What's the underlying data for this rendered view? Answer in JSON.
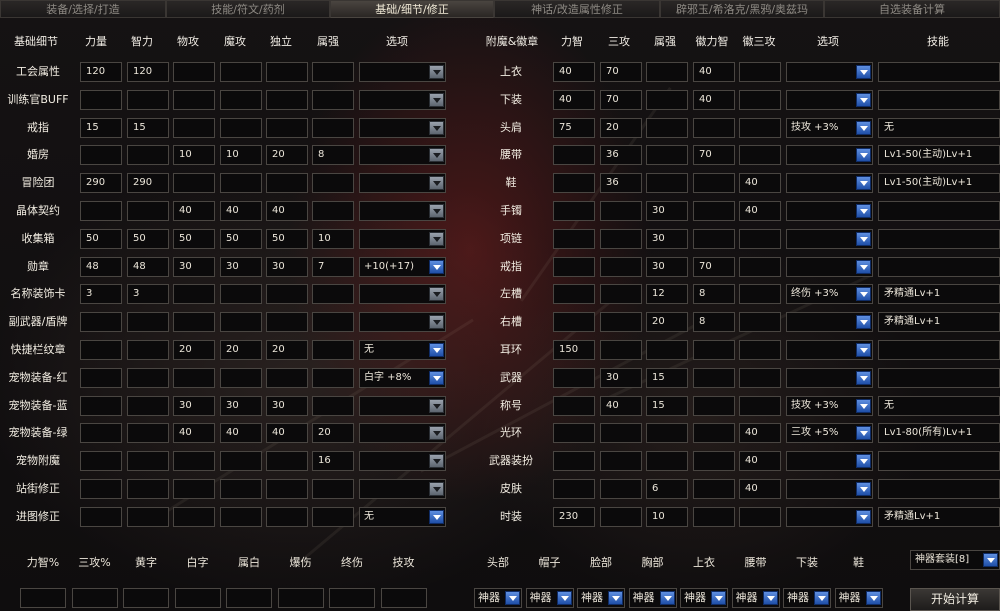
{
  "tabs": [
    "装备/选择/打造",
    "技能/符文/药剂",
    "基础/细节/修正",
    "神话/改造属性修正",
    "辟邪玉/希洛克/黑鸦/奥兹玛",
    "自选装备计算"
  ],
  "active_tab": 2,
  "left": {
    "headers": [
      "基础细节",
      "力量",
      "智力",
      "物攻",
      "魔攻",
      "独立",
      "属强",
      "选项"
    ],
    "rows": [
      {
        "label": "工会属性",
        "values": [
          "120",
          "120",
          "",
          "",
          "",
          ""
        ],
        "option": "",
        "blue": false
      },
      {
        "label": "训练官BUFF",
        "values": [
          "",
          "",
          "",
          "",
          "",
          ""
        ],
        "option": "",
        "blue": false
      },
      {
        "label": "戒指",
        "values": [
          "15",
          "15",
          "",
          "",
          "",
          ""
        ],
        "option": "",
        "blue": false
      },
      {
        "label": "婚房",
        "values": [
          "",
          "",
          "10",
          "10",
          "20",
          "8"
        ],
        "option": "",
        "blue": false
      },
      {
        "label": "冒险团",
        "values": [
          "290",
          "290",
          "",
          "",
          "",
          ""
        ],
        "option": "",
        "blue": false
      },
      {
        "label": "晶体契约",
        "values": [
          "",
          "",
          "40",
          "40",
          "40",
          ""
        ],
        "option": "",
        "blue": false
      },
      {
        "label": "收集箱",
        "values": [
          "50",
          "50",
          "50",
          "50",
          "50",
          "10"
        ],
        "option": "",
        "blue": false
      },
      {
        "label": "勋章",
        "values": [
          "48",
          "48",
          "30",
          "30",
          "30",
          "7"
        ],
        "option": "+10(+17)",
        "blue": true
      },
      {
        "label": "名称装饰卡",
        "values": [
          "3",
          "3",
          "",
          "",
          "",
          ""
        ],
        "option": "",
        "blue": false
      },
      {
        "label": "副武器/盾牌",
        "values": [
          "",
          "",
          "",
          "",
          "",
          ""
        ],
        "option": "",
        "blue": false
      },
      {
        "label": "快捷栏纹章",
        "values": [
          "",
          "",
          "20",
          "20",
          "20",
          ""
        ],
        "option": "无",
        "blue": true
      },
      {
        "label": "宠物装备-红",
        "values": [
          "",
          "",
          "",
          "",
          "",
          ""
        ],
        "option": "白字 +8%",
        "blue": true
      },
      {
        "label": "宠物装备-蓝",
        "values": [
          "",
          "",
          "30",
          "30",
          "30",
          ""
        ],
        "option": "",
        "blue": false
      },
      {
        "label": "宠物装备-绿",
        "values": [
          "",
          "",
          "40",
          "40",
          "40",
          "20"
        ],
        "option": "",
        "blue": false
      },
      {
        "label": "宠物附魔",
        "values": [
          "",
          "",
          "",
          "",
          "",
          "16"
        ],
        "option": "",
        "blue": false
      },
      {
        "label": "站街修正",
        "values": [
          "",
          "",
          "",
          "",
          "",
          ""
        ],
        "option": "",
        "blue": false
      },
      {
        "label": "进图修正",
        "values": [
          "",
          "",
          "",
          "",
          "",
          ""
        ],
        "option": "无",
        "blue": true
      }
    ]
  },
  "right": {
    "headers": [
      "附魔&徽章",
      "力智",
      "三攻",
      "属强",
      "徽力智",
      "徽三攻",
      "选项",
      "技能"
    ],
    "rows": [
      {
        "label": "上衣",
        "values": [
          "40",
          "70",
          "",
          "40",
          ""
        ],
        "option": "",
        "skill": ""
      },
      {
        "label": "下装",
        "values": [
          "40",
          "70",
          "",
          "40",
          ""
        ],
        "option": "",
        "skill": ""
      },
      {
        "label": "头肩",
        "values": [
          "75",
          "20",
          "",
          "",
          ""
        ],
        "option": "技攻 +3%",
        "skill": "无"
      },
      {
        "label": "腰带",
        "values": [
          "",
          "36",
          "",
          "70",
          ""
        ],
        "option": "",
        "skill": "Lv1-50(主动)Lv+1"
      },
      {
        "label": "鞋",
        "values": [
          "",
          "36",
          "",
          "",
          "40"
        ],
        "option": "",
        "skill": "Lv1-50(主动)Lv+1"
      },
      {
        "label": "手镯",
        "values": [
          "",
          "",
          "30",
          "",
          "40"
        ],
        "option": "",
        "skill": ""
      },
      {
        "label": "项链",
        "values": [
          "",
          "",
          "30",
          "",
          ""
        ],
        "option": "",
        "skill": ""
      },
      {
        "label": "戒指",
        "values": [
          "",
          "",
          "30",
          "70",
          ""
        ],
        "option": "",
        "skill": ""
      },
      {
        "label": "左槽",
        "values": [
          "",
          "",
          "12",
          "8",
          ""
        ],
        "option": "终伤 +3%",
        "skill": "矛精通Lv+1"
      },
      {
        "label": "右槽",
        "values": [
          "",
          "",
          "20",
          "8",
          ""
        ],
        "option": "",
        "skill": "矛精通Lv+1"
      },
      {
        "label": "耳环",
        "values": [
          "150",
          "",
          "",
          "",
          ""
        ],
        "option": "",
        "skill": ""
      },
      {
        "label": "武器",
        "values": [
          "",
          "30",
          "15",
          "",
          ""
        ],
        "option": "",
        "skill": ""
      },
      {
        "label": "称号",
        "values": [
          "",
          "40",
          "15",
          "",
          ""
        ],
        "option": "技攻 +3%",
        "skill": "无"
      },
      {
        "label": "光环",
        "values": [
          "",
          "",
          "",
          "",
          "40"
        ],
        "option": "三攻 +5%",
        "skill": "Lv1-80(所有)Lv+1"
      },
      {
        "label": "武器装扮",
        "values": [
          "",
          "",
          "",
          "",
          "40"
        ],
        "option": "",
        "skill": ""
      },
      {
        "label": "皮肤",
        "values": [
          "",
          "",
          "6",
          "",
          "40"
        ],
        "option": "",
        "skill": ""
      },
      {
        "label": "时装",
        "values": [
          "230",
          "",
          "10",
          "",
          ""
        ],
        "option": "",
        "skill": "矛精通Lv+1"
      }
    ]
  },
  "bottom_left": {
    "labels": [
      "力智%",
      "三攻%",
      "黄字",
      "白字",
      "属白",
      "爆伤",
      "终伤",
      "技攻"
    ]
  },
  "bottom_right": {
    "labels": [
      "头部",
      "帽子",
      "脸部",
      "胸部",
      "上衣",
      "腰带",
      "下装",
      "鞋"
    ],
    "selects": [
      "神器",
      "神器",
      "神器",
      "神器",
      "神器",
      "神器",
      "神器",
      "神器"
    ]
  },
  "set_select": "神器套装[8]",
  "start_button": "开始计算"
}
